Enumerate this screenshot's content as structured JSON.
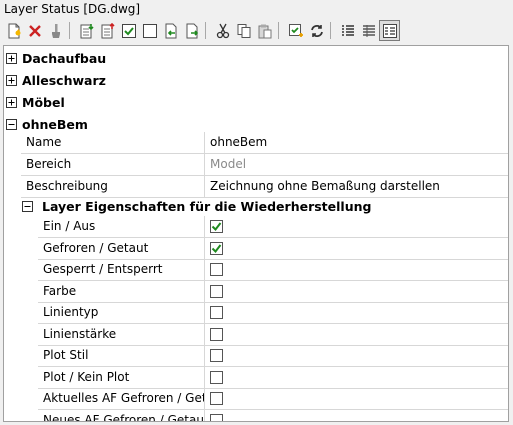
{
  "window": {
    "title": "Layer Status [DG.dwg]"
  },
  "toolbar": {
    "buttons": [
      {
        "icon": "new-state-icon",
        "tooltip": ""
      },
      {
        "icon": "delete-icon"
      },
      {
        "icon": "brush-icon"
      },
      {
        "icon": "import-icon"
      },
      {
        "icon": "export-icon"
      },
      {
        "icon": "check-all-icon"
      },
      {
        "icon": "uncheck-all-icon"
      },
      {
        "icon": "restore-icon"
      },
      {
        "icon": "edit-layers-icon"
      },
      {
        "icon": "cut-icon"
      },
      {
        "icon": "copy-icon"
      },
      {
        "icon": "paste-icon"
      },
      {
        "icon": "add-icon"
      },
      {
        "icon": "refresh-icon"
      },
      {
        "icon": "list-view-icon"
      },
      {
        "icon": "detail-view-icon"
      },
      {
        "icon": "property-view-icon"
      }
    ]
  },
  "tree": {
    "groups": [
      {
        "label": "Dachaufbau",
        "expanded": false
      },
      {
        "label": "Alleschwarz",
        "expanded": false
      },
      {
        "label": "Möbel",
        "expanded": false
      },
      {
        "label": "ohneBem",
        "expanded": true
      }
    ],
    "properties": [
      {
        "key": "Name",
        "value": "ohneBem",
        "dim": false
      },
      {
        "key": "Bereich",
        "value": "Model",
        "dim": true
      },
      {
        "key": "Beschreibung",
        "value": "Zeichnung ohne Bemaßung darstellen",
        "dim": false
      }
    ],
    "subgroup": {
      "label": "Layer Eigenschaften für die Wiederherstellung",
      "expanded": true
    },
    "layer_props": [
      {
        "key": "Ein / Aus",
        "checked": true
      },
      {
        "key": "Gefroren / Getaut",
        "checked": true
      },
      {
        "key": "Gesperrt / Entsperrt",
        "checked": false
      },
      {
        "key": "Farbe",
        "checked": false
      },
      {
        "key": "Linientyp",
        "checked": false
      },
      {
        "key": "Linienstärke",
        "checked": false
      },
      {
        "key": "Plot Stil",
        "checked": false
      },
      {
        "key": "Plot / Kein Plot",
        "checked": false
      },
      {
        "key": "Aktuelles AF Gefroren / Getaut",
        "checked": false
      },
      {
        "key": "Neues AF Gefroren / Getaut",
        "checked": false
      }
    ]
  },
  "colors": {
    "check": "#1f8a1f",
    "delete": "#cc2222",
    "accent": "#2a6fc0"
  }
}
